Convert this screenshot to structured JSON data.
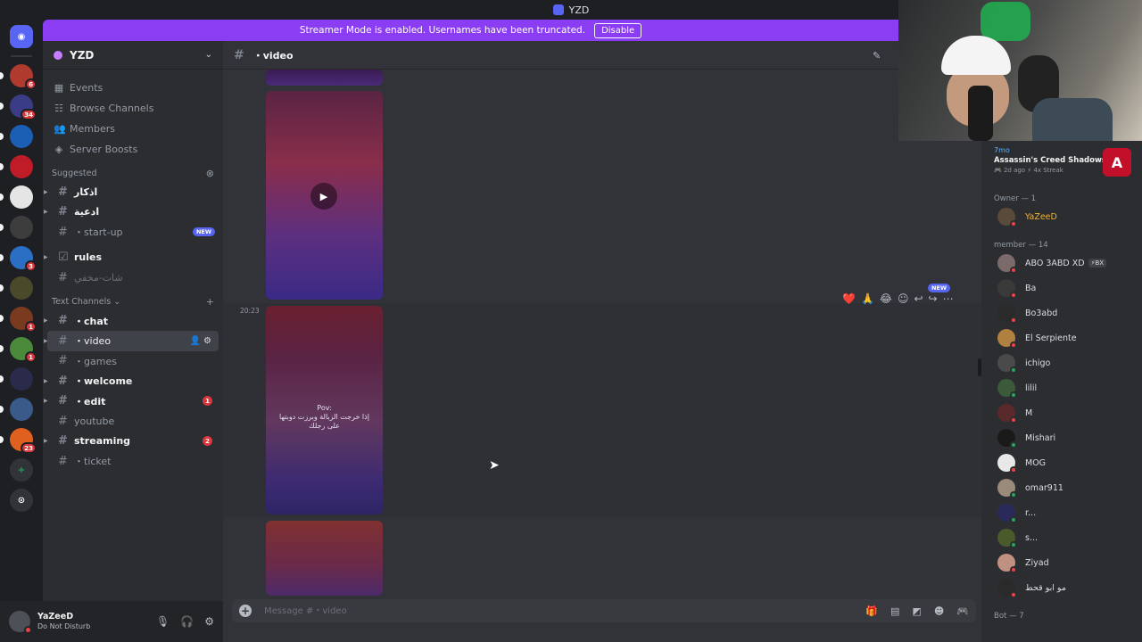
{
  "window": {
    "title": "YZD"
  },
  "banner": {
    "text": "Streamer Mode is enabled. Usernames have been truncated.",
    "disable_label": "Disable",
    "color": "#8a3df2"
  },
  "rail": {
    "servers": [
      {
        "name": "server-1",
        "badge": "6"
      },
      {
        "name": "server-2",
        "badge": "34"
      },
      {
        "name": "server-3",
        "badge": ""
      },
      {
        "name": "server-4",
        "badge": ""
      },
      {
        "name": "server-5",
        "badge": ""
      },
      {
        "name": "server-6",
        "badge": ""
      },
      {
        "name": "server-7",
        "badge": "3"
      },
      {
        "name": "server-8",
        "badge": ""
      },
      {
        "name": "server-9",
        "badge": "1"
      },
      {
        "name": "server-10",
        "badge": "1"
      },
      {
        "name": "server-11",
        "badge": ""
      },
      {
        "name": "server-12",
        "badge": ""
      },
      {
        "name": "server-13",
        "badge": "23"
      }
    ]
  },
  "server": {
    "name": "YZD",
    "nav": [
      {
        "label": "Events",
        "icon": "calendar-icon"
      },
      {
        "label": "Browse Channels",
        "icon": "browse-icon"
      },
      {
        "label": "Members",
        "icon": "members-icon"
      },
      {
        "label": "Server Boosts",
        "icon": "boost-icon"
      }
    ],
    "suggested_label": "Suggested",
    "suggested": [
      {
        "name": "اذكار",
        "bold": true,
        "arrow": true
      },
      {
        "name": "ادعية",
        "bold": true,
        "arrow": true
      },
      {
        "name": "・start-up",
        "bold": false,
        "new": "NEW"
      }
    ],
    "rules": {
      "name": "rules"
    },
    "misc": {
      "name": "شات-مخفي"
    },
    "text_channels_label": "Text Channels",
    "channels": [
      {
        "name": "・chat",
        "bold": true,
        "arrow": true
      },
      {
        "name": "・video",
        "active": true,
        "arrow": true
      },
      {
        "name": "・games",
        "bold": false
      },
      {
        "name": "・welcome",
        "bold": true,
        "arrow": true
      },
      {
        "name": "・edit",
        "bold": true,
        "arrow": true,
        "count": "1"
      },
      {
        "name": "youtube",
        "bold": false
      },
      {
        "name": "streaming",
        "bold": true,
        "arrow": true,
        "count": "2"
      },
      {
        "name": "・ticket",
        "bold": false
      }
    ]
  },
  "user": {
    "name": "YaZeeD",
    "status": "Do Not Disturb"
  },
  "channel": {
    "name": "・video",
    "timestamp": "20:23",
    "caption_line1": "Pov:",
    "caption_line2": "إذا خرجت الزبالة وبرزت دوبتها",
    "caption_line3": "على رجلك",
    "reactions": [
      "❤️",
      "🙏",
      "😂"
    ],
    "new_tag": "NEW",
    "composer_placeholder": "Message #・video"
  },
  "members": {
    "activity": {
      "time": "7mo",
      "game": "Assassin's Creed Shadows",
      "meta": "🎮 2d ago  ⚡ 4x Streak"
    },
    "groups": [
      {
        "title": "Owner — 1",
        "list": [
          {
            "name": "YaZeeD",
            "status": "#f23f43",
            "color": "#f0b232"
          }
        ]
      },
      {
        "title": "member — 14",
        "list": [
          {
            "name": "ABO 3ABD XD",
            "status": "#f23f43",
            "tag": "⚡BX"
          },
          {
            "name": "Ba",
            "status": "#f23f43"
          },
          {
            "name": "Bo3abd",
            "status": "#f23f43"
          },
          {
            "name": "El Serpiente",
            "status": "#f23f43"
          },
          {
            "name": "ichigo",
            "status": "#23a55a"
          },
          {
            "name": "lilil",
            "status": "#23a55a"
          },
          {
            "name": "M",
            "status": "#f23f43"
          },
          {
            "name": "Mishari",
            "status": "#23a55a"
          },
          {
            "name": "MOG",
            "status": "#f23f43"
          },
          {
            "name": "omar911",
            "status": "#23a55a"
          },
          {
            "name": "r...",
            "status": "#23a55a"
          },
          {
            "name": "s...",
            "status": "#23a55a"
          },
          {
            "name": "Ziyad",
            "status": "#f23f43"
          },
          {
            "name": "مو ابو قحط",
            "status": "#f23f43"
          }
        ]
      },
      {
        "title": "Bot — 7",
        "list": []
      }
    ]
  }
}
